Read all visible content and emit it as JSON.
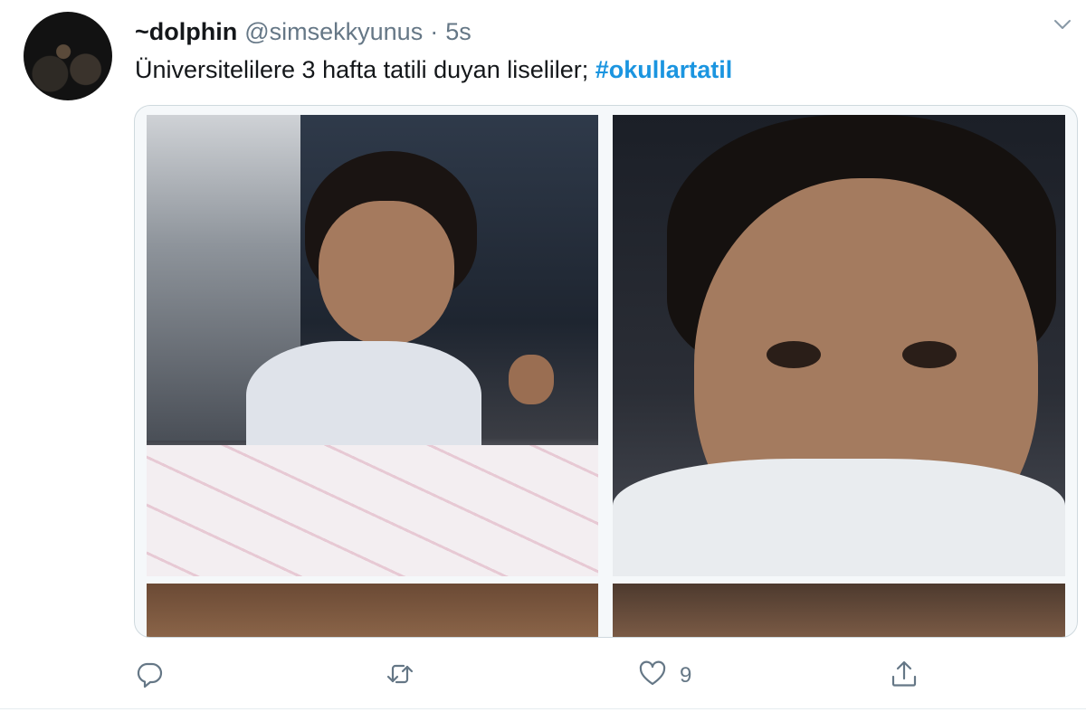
{
  "tweet": {
    "display_name": "~dolphin",
    "handle": "@simsekkyunus",
    "separator": "·",
    "time": "5s",
    "text": "Üniversitelilere 3 hafta tatili duyan liseliler;",
    "hashtag": "#okullartatil",
    "avatar_icon": "user-avatar",
    "menu_icon": "chevron-down-icon"
  },
  "media": {
    "photos": [
      "photo-1",
      "photo-2",
      "photo-3",
      "photo-4"
    ]
  },
  "actions": {
    "reply_icon": "reply-icon",
    "retweet_icon": "retweet-icon",
    "like_icon": "heart-icon",
    "like_count": "9",
    "share_icon": "share-icon"
  },
  "colors": {
    "hashtag": "#1b95e0",
    "secondary_text": "#657786",
    "primary_text": "#14171a"
  }
}
